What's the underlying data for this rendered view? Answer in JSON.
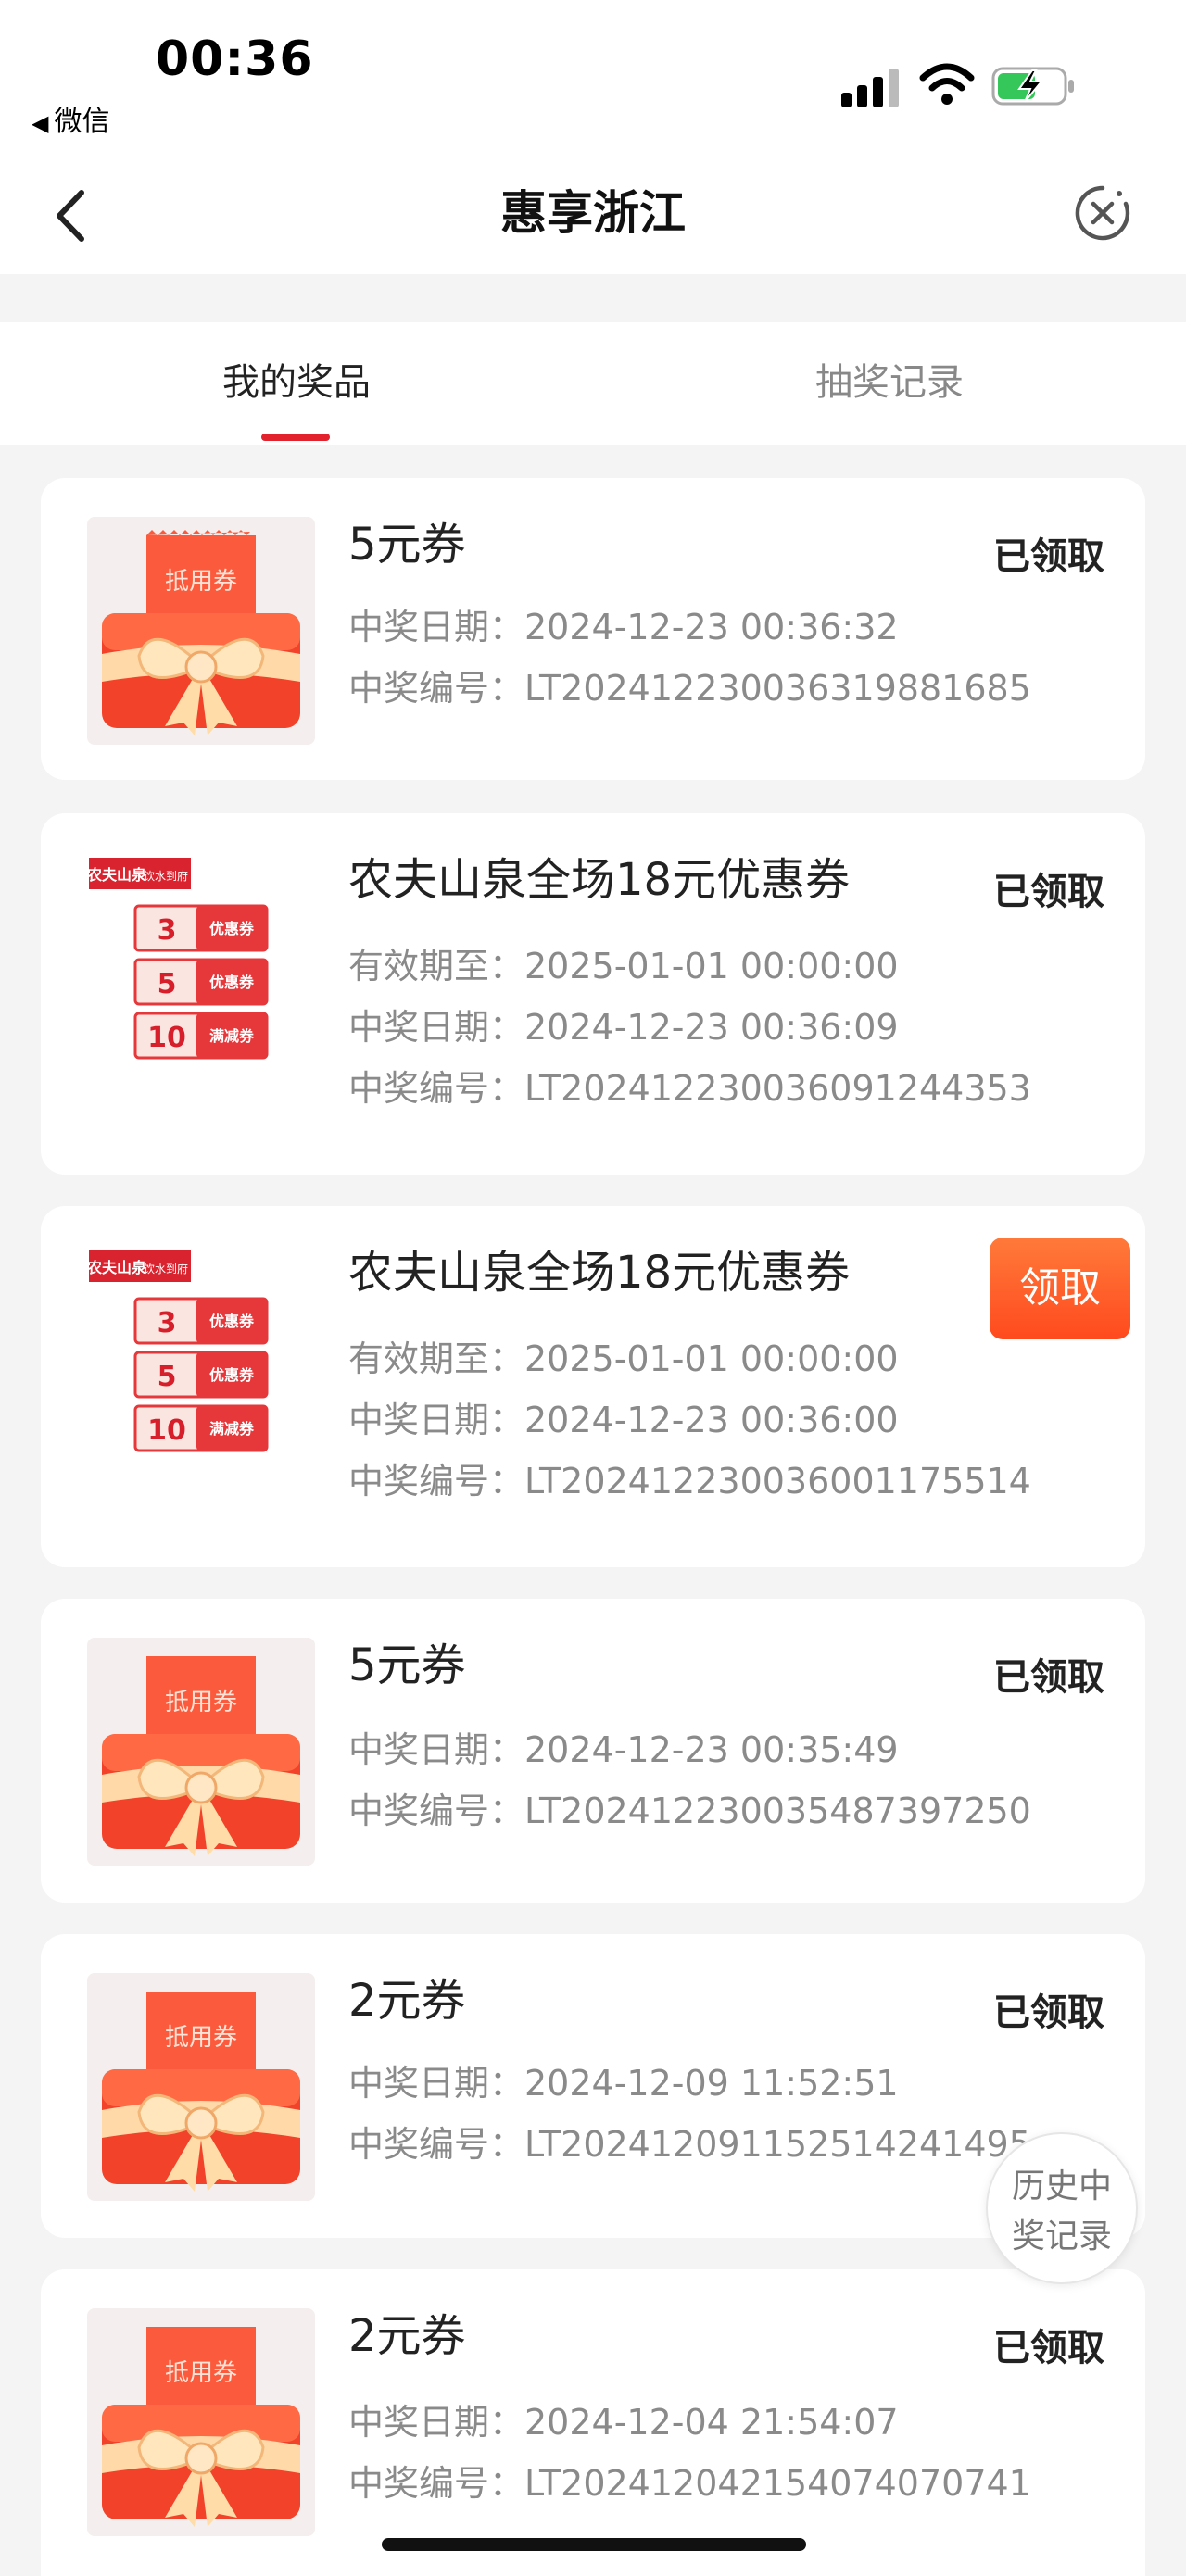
{
  "status_bar": {
    "time": "00:36",
    "back_app": "微信",
    "back_arrow": "◀"
  },
  "nav": {
    "title": "惠享浙江",
    "back_icon": "chevron-left-icon",
    "close_icon": "close-circle-icon"
  },
  "tabs": [
    {
      "label": "我的奖品",
      "active": true
    },
    {
      "label": "抽奖记录",
      "active": false
    }
  ],
  "thumb_text": {
    "coupon": "抵用券",
    "brand": "农夫山泉",
    "brand_sub": "饮水到府",
    "v3": "3",
    "v5": "5",
    "v10": "10",
    "yhq": "优惠券",
    "mjq": "满减券",
    "yuan": "'"
  },
  "prizes": [
    {
      "title": "5元券",
      "lines": [
        "中奖日期：2024-12-23 00:36:32",
        "中奖编号：LT20241223003631988168​5"
      ],
      "status": "已领取",
      "claimable": false,
      "image": "coupon"
    },
    {
      "title": "农夫山泉全场18元优惠券",
      "lines": [
        "有效期至：2025-01-01 00:00:00",
        "中奖日期：2024-12-23 00:36:09",
        "中奖编号：LT20241223003609124435​3"
      ],
      "status": "已领取",
      "claimable": false,
      "image": "nongfu"
    },
    {
      "title": "农夫山泉全场18元优惠券",
      "lines": [
        "有效期至：2025-01-01 00:00:00",
        "中奖日期：2024-12-23 00:36:00",
        "中奖编号：LT20241223003600117551​4"
      ],
      "status": "领取",
      "claimable": true,
      "image": "nongfu"
    },
    {
      "title": "5元券",
      "lines": [
        "中奖日期：2024-12-23 00:35:49",
        "中奖编号：LT20241223003548739725​0"
      ],
      "status": "已领取",
      "claimable": false,
      "image": "coupon"
    },
    {
      "title": "2元券",
      "lines": [
        "中奖日期：2024-12-09 11:52:51",
        "中奖编号：LT20241209115251424149​5"
      ],
      "status": "已领取",
      "claimable": false,
      "image": "coupon"
    },
    {
      "title": "2元券",
      "lines": [
        "中奖日期：2024-12-04 21:54:07",
        "中奖编号：LT20241204215407407074​1"
      ],
      "status": "已领取",
      "claimable": false,
      "image": "coupon"
    }
  ],
  "history_button": {
    "line1": "历史中",
    "line2": "奖记录"
  },
  "colors": {
    "accent": "#e2232e",
    "claim_button": "#ff5a26",
    "card_bg": "#ffffff",
    "page_bg": "#f4f4f4"
  }
}
